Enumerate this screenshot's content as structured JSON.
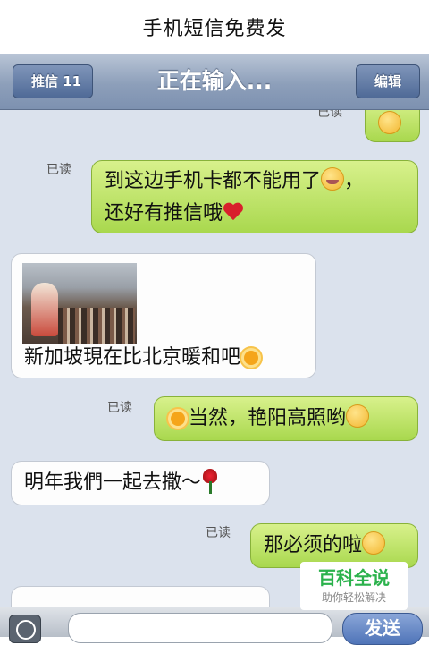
{
  "caption": "手机短信免费发",
  "navbar": {
    "back_label": "推信 11",
    "title": "正在输入...",
    "edit_label": "编辑"
  },
  "read_label": "已读",
  "messages": [
    {
      "from": "me",
      "text": "",
      "emoji": "cry-smile"
    },
    {
      "from": "me",
      "line1": "到这边手机卡都不能用了",
      "line1_end": "，",
      "line2": "还好有推信哦",
      "emoji": [
        "crying-face",
        "heart"
      ]
    },
    {
      "from": "other",
      "text": "新加坡現在比北京暖和吧",
      "emoji": "sun",
      "has_photo": true
    },
    {
      "from": "me",
      "text": "当然，艳阳高照哟",
      "emoji": [
        "sun",
        "wink-face"
      ]
    },
    {
      "from": "other",
      "text": "明年我們一起去撒～",
      "emoji": "rose"
    },
    {
      "from": "me",
      "text": "那必须的啦",
      "emoji": "kiss-face"
    }
  ],
  "inputbar": {
    "send_label": "发送",
    "emoji_button": "smiley-icon"
  },
  "watermark": {
    "main": "百科全说",
    "sub": "助你轻松解决"
  },
  "colors": {
    "navbar": "#8d9fba",
    "chat_bg": "#dbe2ed",
    "me_bubble": "#b6e05a",
    "other_bubble": "#fdfdfd",
    "send": "#4f74b8"
  }
}
